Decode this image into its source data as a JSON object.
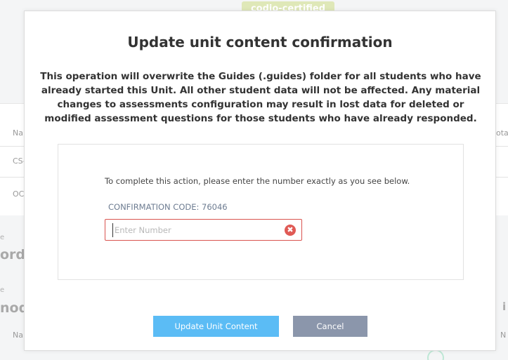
{
  "background": {
    "badge": "codio-certified",
    "col_name_1": "Na",
    "row_1": "CS-",
    "row_2": "OC",
    "col_total": "otal",
    "section_1_label": "e",
    "section_1_title": "orde",
    "section_2_label": "e",
    "section_2_title": "nod",
    "col_name_2": "Na",
    "right_frag_1": "i",
    "right_frag_2": "N"
  },
  "modal": {
    "title": "Update unit content confirmation",
    "warning": "This operation will overwrite the Guides (.guides) folder for all students who have already started this Unit. All other student data will not be affected. Any material changes to assessments configuration may result in lost data for deleted or modified assessment questions for those students who have already responded.",
    "instruction": "To complete this action, please enter the number exactly as you see below.",
    "code_line": "CONFIRMATION CODE: 76046",
    "input": {
      "value": "",
      "placeholder": "Enter Number"
    },
    "clear_glyph": "✖",
    "primary_button": "Update Unit Content",
    "cancel_button": "Cancel"
  },
  "colors": {
    "primary_button": "#5bbcf5",
    "cancel_button": "#8b96ab",
    "error_border": "#d9534f",
    "code_text": "#6d7c91"
  }
}
